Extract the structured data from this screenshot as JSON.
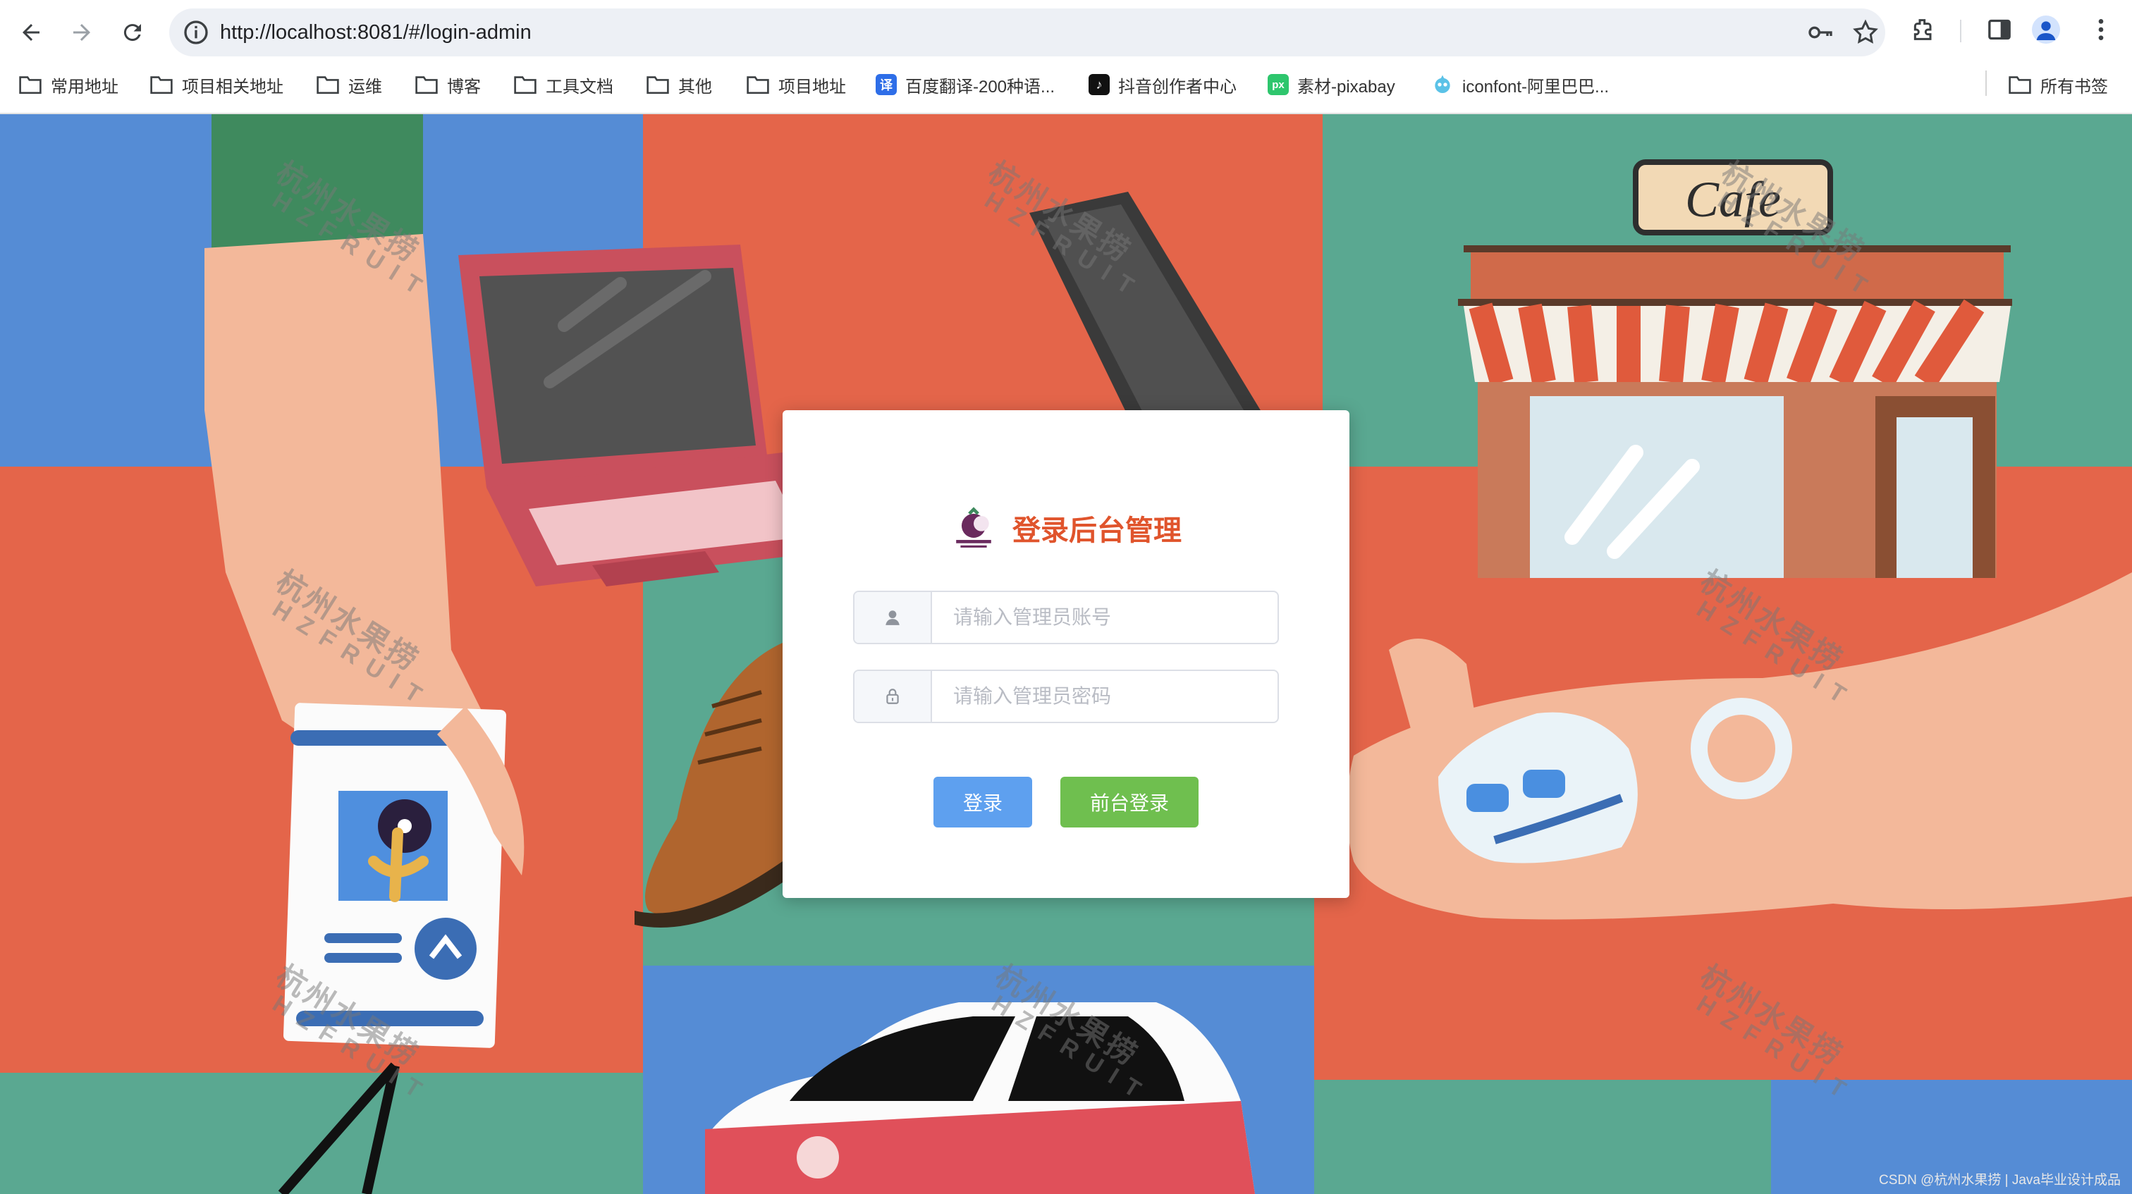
{
  "browser": {
    "url": "http://localhost:8081/#/login-admin",
    "bookmarks": [
      {
        "label": "常用地址",
        "icon": "folder-icon"
      },
      {
        "label": "项目相关地址",
        "icon": "folder-icon"
      },
      {
        "label": "运维",
        "icon": "folder-icon"
      },
      {
        "label": "博客",
        "icon": "folder-icon"
      },
      {
        "label": "工具文档",
        "icon": "folder-icon"
      },
      {
        "label": "其他",
        "icon": "folder-icon"
      },
      {
        "label": "项目地址",
        "icon": "folder-icon"
      },
      {
        "label": "百度翻译-200种语...",
        "icon": "baidu-translate-icon",
        "favicon_text": "译"
      },
      {
        "label": "抖音创作者中心",
        "icon": "douyin-icon",
        "favicon_text": "♪"
      },
      {
        "label": "素材-pixabay",
        "icon": "pixabay-icon",
        "favicon_text": "px"
      },
      {
        "label": "iconfont-阿里巴巴...",
        "icon": "iconfont-icon"
      }
    ],
    "all_bookmarks": "所有书签"
  },
  "login": {
    "title": "登录后台管理",
    "username_placeholder": "请输入管理员账号",
    "password_placeholder": "请输入管理员密码",
    "login_button": "登录",
    "frontend_login_button": "前台登录"
  },
  "watermark": {
    "line1": "杭州水果捞",
    "line2": "HZFRUIT"
  },
  "footer": "CSDN @杭州水果捞 | Java毕业设计成品",
  "colors": {
    "accent_title": "#e0542c",
    "login_button": "#5ea0ef",
    "frontend_button": "#6fbf4f",
    "bg_blue": "#558cd5",
    "bg_red": "#e4654a",
    "bg_green": "#5aa891"
  }
}
